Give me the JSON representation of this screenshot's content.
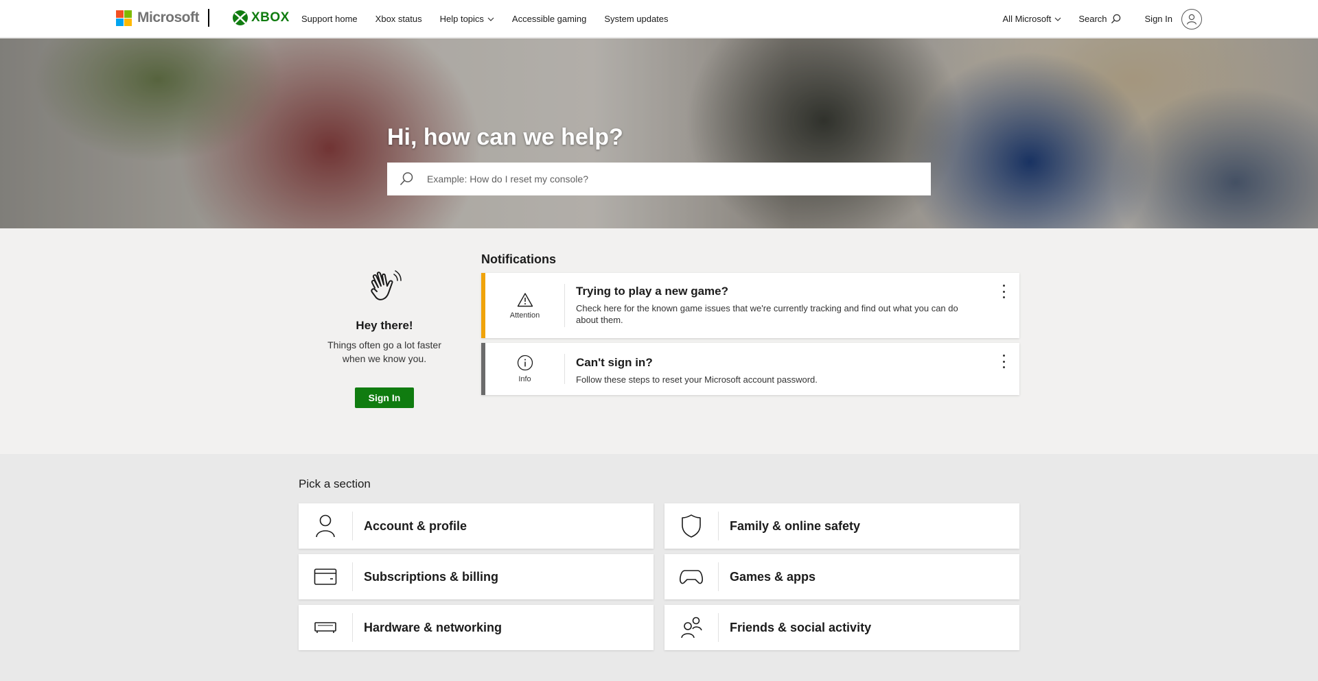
{
  "header": {
    "ms_brand": "Microsoft",
    "xbox_brand": "XBOX",
    "nav": [
      {
        "label": "Support home"
      },
      {
        "label": "Xbox status"
      },
      {
        "label": "Help topics",
        "has_dropdown": true
      },
      {
        "label": "Accessible gaming"
      },
      {
        "label": "System updates"
      }
    ],
    "all_microsoft": "All Microsoft",
    "search_label": "Search",
    "sign_in": "Sign In"
  },
  "hero": {
    "title": "Hi, how can we help?",
    "search_placeholder": "Example: How do I reset my console?"
  },
  "welcome": {
    "icon": "wave-hand-icon",
    "heading": "Hey there!",
    "text": "Things often go a lot faster when we know you.",
    "button": "Sign In"
  },
  "notifications": {
    "title": "Notifications",
    "items": [
      {
        "kind": "Attention",
        "icon": "warning-icon",
        "color": "#f0a30a",
        "title": "Trying to play a new game?",
        "text": "Check here for the known game issues that we're currently tracking and find out what you can do about them."
      },
      {
        "kind": "Info",
        "icon": "info-icon",
        "color": "#6b6b6b",
        "title": "Can't sign in?",
        "text": "Follow these steps to reset your Microsoft account password."
      }
    ]
  },
  "sections": {
    "title": "Pick a section",
    "items": [
      {
        "label": "Account & profile",
        "icon": "person-icon"
      },
      {
        "label": "Family & online safety",
        "icon": "shield-icon"
      },
      {
        "label": "Subscriptions & billing",
        "icon": "card-icon"
      },
      {
        "label": "Games & apps",
        "icon": "controller-icon"
      },
      {
        "label": "Hardware & networking",
        "icon": "console-icon"
      },
      {
        "label": "Friends & social activity",
        "icon": "people-icon"
      }
    ]
  },
  "colors": {
    "xbox_green": "#107c10",
    "attention": "#f0a30a",
    "info": "#6b6b6b"
  }
}
